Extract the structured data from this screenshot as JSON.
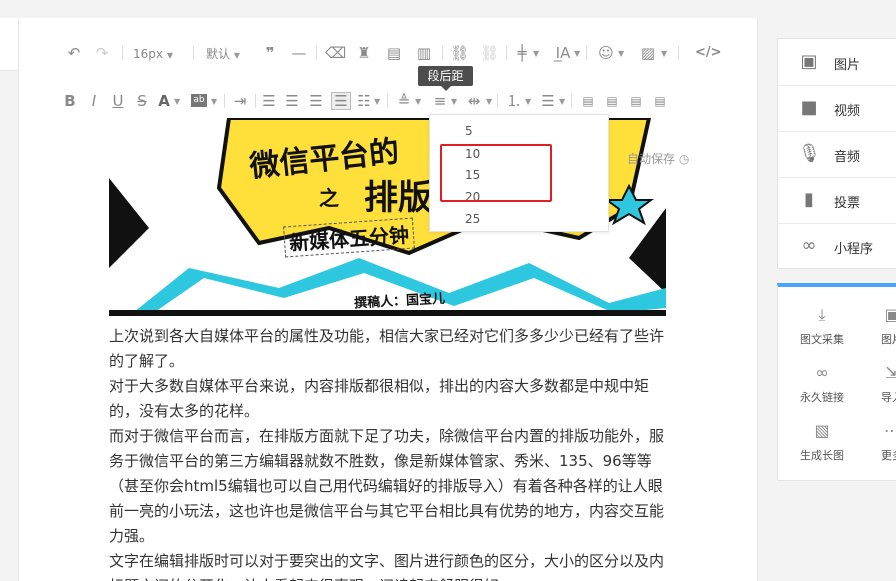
{
  "toolbar": {
    "font_size": "16px",
    "font_family": "默认",
    "tooltip": "段后距"
  },
  "dropdown": {
    "options": [
      "5",
      "10",
      "15",
      "20",
      "25"
    ]
  },
  "autosave": "自动保存",
  "banner": {
    "line1": "微信平台的",
    "line2_a": "之",
    "line2_b": "排版",
    "line3": "新媒体五分钟",
    "author": "撰稿人：国宝儿"
  },
  "content": {
    "paragraphs": [
      "上次说到各大自媒体平台的属性及功能，相信大家已经对它们多多少少已经有了些许的了解了。",
      "对于大多数自媒体平台来说，内容排版都很相似，排出的内容大多数都是中规中矩的，没有太多的花样。",
      "而对于微信平台而言，在排版方面就下足了功夫，除微信平台内置的排版功能外，服务于微信平台的第三方编辑器就数不胜数，像是新媒体管家、秀米、135、96等等（甚至你会html5编辑也可以自己用代码编辑好的排版导入）有着各种各样的让人眼前一亮的小玩法，这也许也是微信平台与其它平台相比具有优势的地方，内容交互能力强。",
      "文字在编辑排版时可以对于要突出的文字、图片进行颜色的区分，大小的区分以及内标题之间的分开化，让人看起来很直观，阅读起来舒服很好。"
    ]
  },
  "sidebar": {
    "items": [
      {
        "label": "图片",
        "icon": "image-icon"
      },
      {
        "label": "视频",
        "icon": "video-icon"
      },
      {
        "label": "音频",
        "icon": "microphone-icon"
      },
      {
        "label": "投票",
        "icon": "bar-chart-icon"
      },
      {
        "label": "小程序",
        "icon": "link-icon"
      }
    ]
  },
  "tools": {
    "items": [
      {
        "label": "图文采集",
        "icon": "download-icon"
      },
      {
        "label": "图片",
        "icon": "image-icon"
      },
      {
        "label": "永久链接",
        "icon": "link-icon"
      },
      {
        "label": "导入",
        "icon": "import-icon"
      },
      {
        "label": "生成长图",
        "icon": "long-image-icon"
      },
      {
        "label": "更多",
        "icon": "more-icon"
      }
    ]
  },
  "colors": {
    "accent": "#4aa3ff",
    "highlight_box": "#e02020",
    "banner_yellow": "#ffe03a",
    "banner_cyan": "#2ec7e0"
  }
}
